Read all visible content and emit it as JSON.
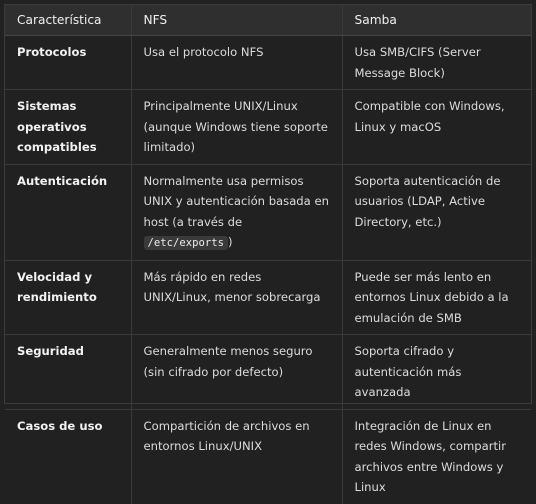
{
  "table": {
    "headers": {
      "feature": "Característica",
      "nfs": "NFS",
      "samba": "Samba"
    },
    "rows": [
      {
        "feature": "Protocolos",
        "nfs": "Usa el protocolo NFS",
        "samba": "Usa SMB/CIFS (Server Message Block)"
      },
      {
        "feature": "Sistemas operativos compatibles",
        "nfs": "Principalmente UNIX/Linux (aunque Windows tiene soporte limitado)",
        "samba": "Compatible con Windows, Linux y macOS"
      },
      {
        "feature": "Autenticación",
        "nfs_prefix": "Normalmente usa permisos UNIX y autenticación basada en host (a través de ",
        "nfs_code": "/etc/exports",
        "nfs_suffix": ")",
        "samba": "Soporta autenticación de usuarios (LDAP, Active Directory, etc.)"
      },
      {
        "feature": "Velocidad y rendimiento",
        "nfs": "Más rápido en redes UNIX/Linux, menor sobrecarga",
        "samba": "Puede ser más lento en entornos Linux debido a la emulación de SMB"
      },
      {
        "feature": "Seguridad",
        "nfs": "Generalmente menos seguro (sin cifrado por defecto)",
        "samba": "Soporta cifrado y autenticación más avanzada"
      },
      {
        "feature": "Casos de uso",
        "nfs": "Compartición de archivos en entornos Linux/UNIX",
        "samba": "Integración de Linux en redes Windows, compartir archivos entre Windows y Linux"
      }
    ]
  }
}
